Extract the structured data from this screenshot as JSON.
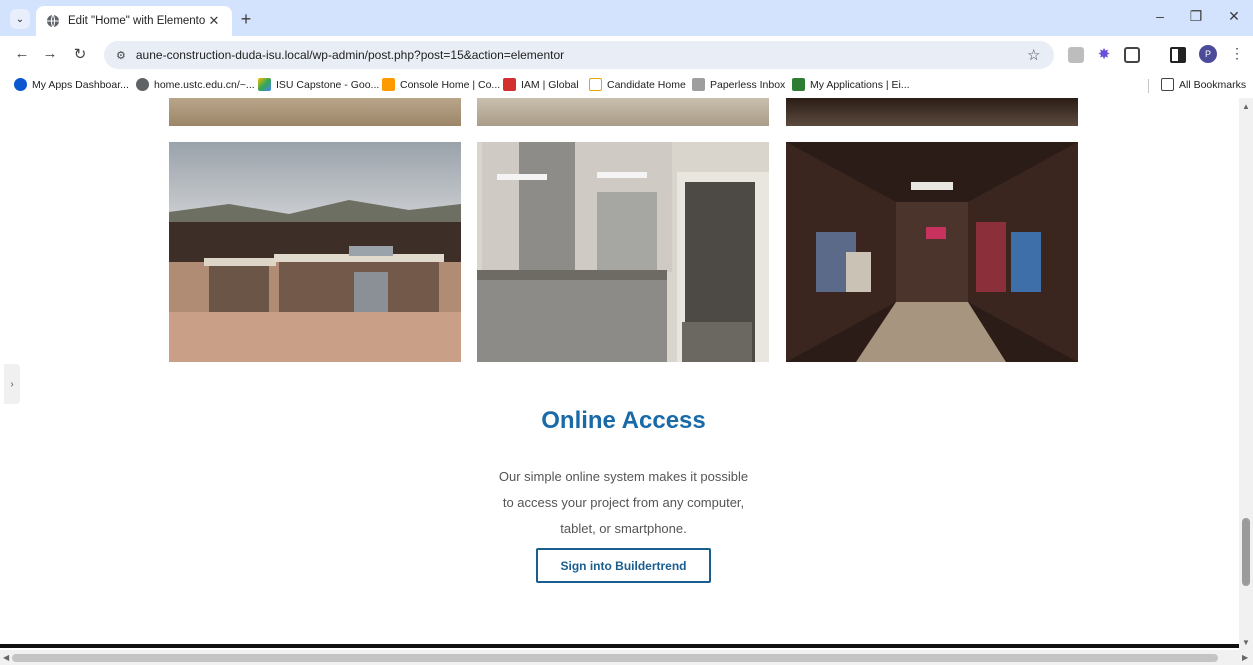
{
  "browser": {
    "tab_title": "Edit \"Home\" with Elementor",
    "url": "aune-construction-duda-isu.local/wp-admin/post.php?post=15&action=elementor",
    "profile_initial": "P",
    "bookmarks": [
      "My Apps Dashboar...",
      "home.ustc.edu.cn/~...",
      "ISU Capstone - Goo...",
      "Console Home | Co...",
      "IAM | Global",
      "Candidate Home",
      "Paperless Inbox",
      "My Applications | Ei..."
    ],
    "all_bookmarks": "All Bookmarks"
  },
  "page": {
    "heading": "Online Access",
    "paragraph_lines": [
      "Our simple online system makes it possible",
      "to access your project from any computer,",
      "tablet, or smartphone."
    ],
    "cta_label": "Sign into Buildertrend"
  },
  "colors": {
    "heading": "#1a6aa8",
    "cta_border": "#1a5d8f",
    "tabstrip_bg": "#d3e3fd"
  }
}
